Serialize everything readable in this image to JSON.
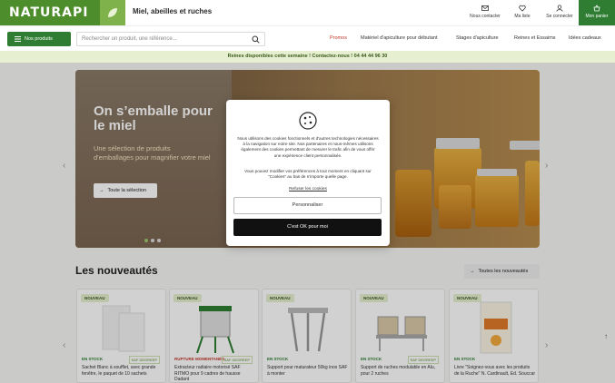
{
  "header": {
    "logo_text": "NATURAPI",
    "tagline": "Miel, abeilles et ruches",
    "contact_label": "Nous contacter",
    "wishlist_label": "Ma liste",
    "login_label": "Se connecter",
    "cart_label": "Mon panier"
  },
  "nav": {
    "products_label": "Nos produits",
    "search_placeholder": "Rechercher un produit, une référence...",
    "links": [
      "Promos",
      "Matériel d'apiculture pour débutant",
      "Stages d'apiculture",
      "Reines et Essaims",
      "Idées cadeaux"
    ]
  },
  "promo_bar": "Reines disponibles cette semaine ! Contactez-nous ! 04 44 44 96 30",
  "hero": {
    "title": "On s’emballe pour le miel",
    "subtitle": "Une sélection de produits d'emballages pour magnifier votre miel",
    "cta": "Toute la sélection"
  },
  "section": {
    "title": "Les nouveautés",
    "all_link": "Toutes les nouveautés"
  },
  "cards": [
    {
      "badge": "NOUVEAU",
      "stock": "EN STOCK",
      "saf": "SAF DEGREEP",
      "name": "Sachet Blanc à soufflet, avec grande fenêtre, le paquet de 10 sachets"
    },
    {
      "badge": "NOUVEAU",
      "stock": "RUPTURE MOMENTANÉE",
      "saf": "SAF DEGREEP",
      "name": "Extracteur radiaire motorisé SAF RITMO pour 9 cadres de hausse Dadant"
    },
    {
      "badge": "NOUVEAU",
      "stock": "EN STOCK",
      "saf": "",
      "name": "Support pour maturateur 50kg inox SAF à monter"
    },
    {
      "badge": "NOUVEAU",
      "stock": "EN STOCK",
      "saf": "SAF DEGREEP",
      "name": "Support de ruches modulable en Alu, pour 2 ruches"
    },
    {
      "badge": "NOUVEAU",
      "stock": "EN STOCK",
      "saf": "",
      "name": "Livre \"Soignez-vous avec les produits de la Ruche\" N. Cardinault, Ed. Souccar"
    }
  ],
  "cookie": {
    "text1": "Nous utilisons des cookies fonctionnels et d'autres technologies nécessaires à la navigation sur notre site. Nos partenaires et nous-mêmes utilisons également des cookies permettant de mesurer le trafic afin de vous offrir une expérience client personnalisée.",
    "text2": "Vous pouvez modifier vos préférences à tout moment en cliquant sur \"Cookies\" au bas de n'importe quelle page.",
    "refuse": "Refuser les cookies",
    "customize": "Personnaliser",
    "accept": "C'est OK pour moi"
  },
  "colors": {
    "brand_green": "#2e7d32",
    "promo_bg": "#e6efcf"
  }
}
